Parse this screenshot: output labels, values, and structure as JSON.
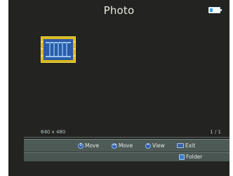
{
  "header": {
    "title": "Photo",
    "battery_icon": "battery-icon"
  },
  "thumbnail": {
    "icon": "image-thumbnail-icon",
    "selected": true
  },
  "status": {
    "dimensions": "640 x 480",
    "page_indicator": "1 / 1"
  },
  "hints": [
    {
      "icon": "updown-arrows-icon",
      "label": "Move"
    },
    {
      "icon": "leftright-arrows-icon",
      "label": "Move"
    },
    {
      "icon": "enter-icon",
      "label": "View"
    },
    {
      "icon": "exit-icon",
      "label": "Exit"
    }
  ],
  "folder_hint": {
    "icon": "folder-icon",
    "label": "Folder"
  },
  "colors": {
    "accent": "#2e5fb0",
    "thumbnail_frame": "#d8b81c",
    "background": "#232321"
  }
}
